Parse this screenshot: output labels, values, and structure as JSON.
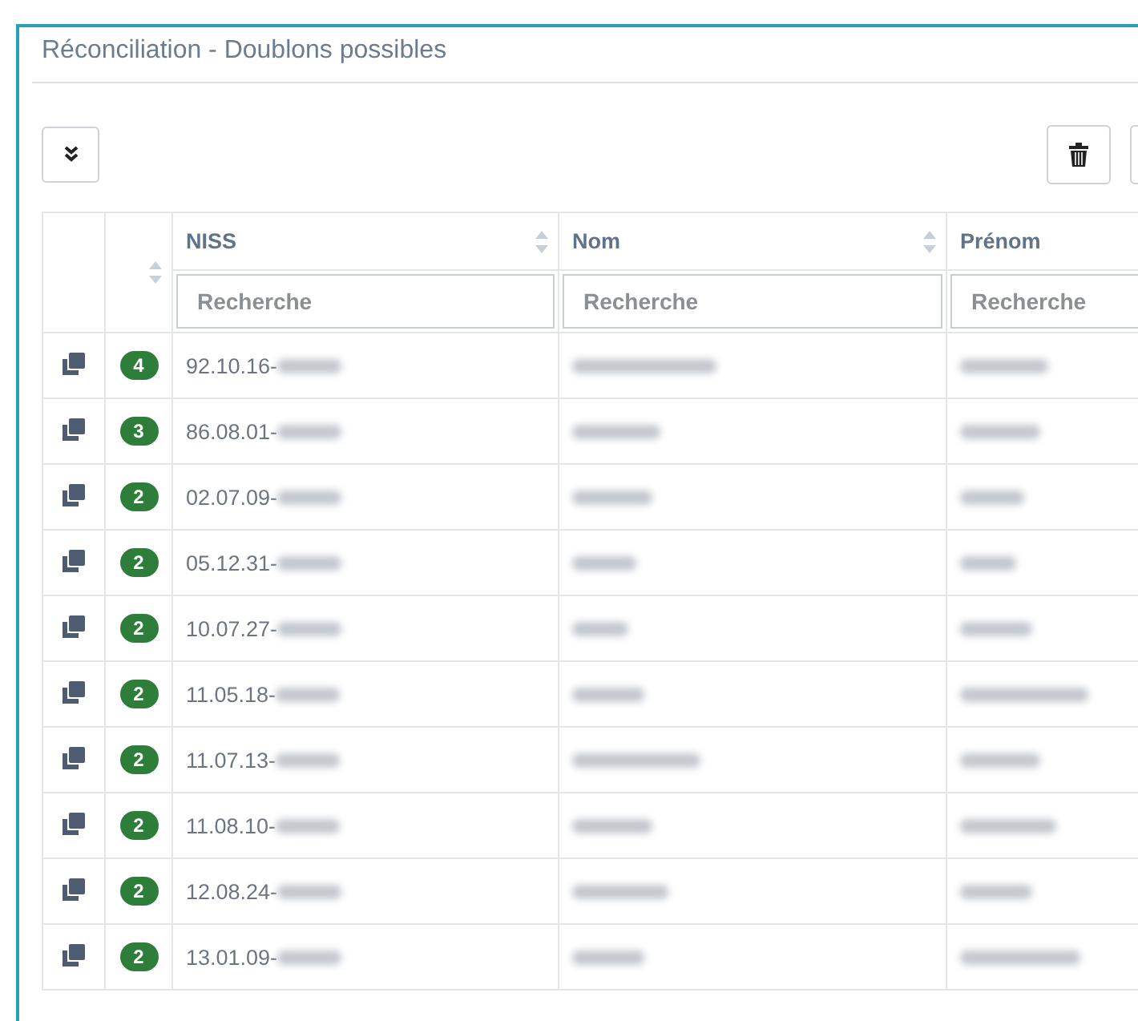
{
  "panel": {
    "title": "Réconciliation - Doublons possibles"
  },
  "columns": [
    {
      "kind": "action",
      "sortable": false
    },
    {
      "kind": "count",
      "sortable": true
    },
    {
      "kind": "text",
      "label": "NISS",
      "sortable": true,
      "placeholder": "Recherche"
    },
    {
      "kind": "text",
      "label": "Nom",
      "sortable": true,
      "placeholder": "Recherche"
    },
    {
      "kind": "text",
      "label": "Prénom",
      "sortable": false,
      "placeholder": "Recherche"
    }
  ],
  "rows": [
    {
      "count": "4",
      "niss": "92.10.16-"
    },
    {
      "count": "3",
      "niss": "86.08.01-"
    },
    {
      "count": "2",
      "niss": "02.07.09-"
    },
    {
      "count": "2",
      "niss": "05.12.31-"
    },
    {
      "count": "2",
      "niss": "10.07.27-"
    },
    {
      "count": "2",
      "niss": "11.05.18-"
    },
    {
      "count": "2",
      "niss": "11.07.13-"
    },
    {
      "count": "2",
      "niss": "11.08.10-"
    },
    {
      "count": "2",
      "niss": "12.08.24-"
    },
    {
      "count": "2",
      "niss": "13.01.09-"
    }
  ]
}
